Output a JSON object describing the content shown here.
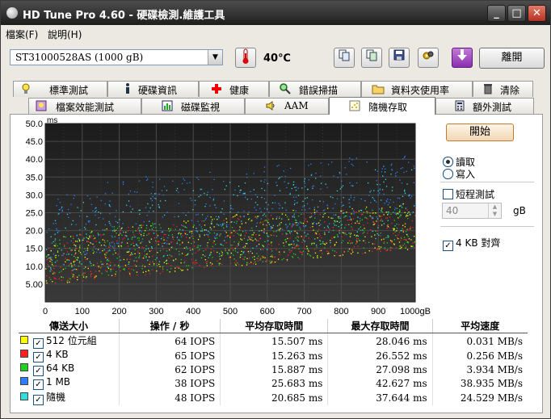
{
  "window": {
    "title": "HD Tune Pro 4.60 - 硬碟檢測.維護工具"
  },
  "menu": {
    "file": "檔案(F)",
    "help": "說明(H)"
  },
  "toolbar": {
    "drive": "ST31000528AS (1000 gB)",
    "temperature": "40℃",
    "exit_label": "離開"
  },
  "tabs": {
    "row1": [
      {
        "label": "標準測試",
        "icon": "lightbulb-icon"
      },
      {
        "label": "硬碟資訊",
        "icon": "info-icon"
      },
      {
        "label": "健康",
        "icon": "health-cross-icon"
      },
      {
        "label": "錯誤掃描",
        "icon": "magnifier-icon"
      },
      {
        "label": "資料夾使用率",
        "icon": "folder-icon"
      },
      {
        "label": "清除",
        "icon": "trash-icon"
      }
    ],
    "row2": [
      {
        "label": "檔案效能測試",
        "icon": "bulb-file-icon"
      },
      {
        "label": "磁碟監視",
        "icon": "monitor-chart-icon"
      },
      {
        "label": "AAM",
        "icon": "speaker-icon"
      },
      {
        "label": "隨機存取",
        "icon": "random-access-icon",
        "active": true
      },
      {
        "label": "額外測試",
        "icon": "calculator-icon"
      }
    ]
  },
  "controls": {
    "start_label": "開始",
    "read_label": "讀取",
    "write_label": "寫入",
    "short_test_label": "短程測試",
    "short_test_value": "40",
    "short_test_unit": "gB",
    "align_label": "4 KB 對齊"
  },
  "chart_data": {
    "type": "scatter",
    "ylabel": "ms",
    "xlabel": "gB",
    "xlim": [
      0,
      1000
    ],
    "ylim": [
      0,
      50
    ],
    "x_ticks": [
      "0",
      "100",
      "200",
      "300",
      "400",
      "500",
      "600",
      "700",
      "800",
      "900",
      "1000gB"
    ],
    "y_ticks": [
      "5.00",
      "10.0",
      "15.0",
      "20.0",
      "25.0",
      "30.0",
      "35.0",
      "40.0",
      "45.0",
      "50.0"
    ],
    "background": "#2b2b2b",
    "grid": true,
    "series": [
      {
        "name": "512 位元組",
        "color": "#ffff00",
        "min_ms": [
          5.0,
          15.0
        ],
        "max_ms": [
          16.0,
          28.0
        ]
      },
      {
        "name": "4 KB",
        "color": "#ff2020",
        "min_ms": [
          5.0,
          15.0
        ],
        "max_ms": [
          16.0,
          27.0
        ]
      },
      {
        "name": "64 KB",
        "color": "#20d020",
        "min_ms": [
          5.5,
          15.5
        ],
        "max_ms": [
          17.0,
          27.0
        ]
      },
      {
        "name": "1 MB",
        "color": "#2a7fff",
        "min_ms": [
          12.0,
          25.0
        ],
        "max_ms": [
          28.0,
          42.0
        ]
      },
      {
        "name": "隨機",
        "color": "#33dddd",
        "min_ms": [
          8.0,
          19.0
        ],
        "max_ms": [
          24.0,
          38.0
        ]
      }
    ]
  },
  "results": {
    "headers": [
      "傳送大小",
      "操作 / 秒",
      "平均存取時間",
      "最大存取時間",
      "平均速度"
    ],
    "rows": [
      {
        "label": "512 位元組",
        "color": "#ffff00",
        "ops": "64 IOPS",
        "avg": "15.507 ms",
        "max": "28.046 ms",
        "speed": "0.031 MB/s"
      },
      {
        "label": "4 KB",
        "color": "#ff2020",
        "ops": "65 IOPS",
        "avg": "15.263 ms",
        "max": "26.552 ms",
        "speed": "0.256 MB/s"
      },
      {
        "label": "64 KB",
        "color": "#20d020",
        "ops": "62 IOPS",
        "avg": "15.887 ms",
        "max": "27.098 ms",
        "speed": "3.934 MB/s"
      },
      {
        "label": "1 MB",
        "color": "#2a7fff",
        "ops": "38 IOPS",
        "avg": "25.683 ms",
        "max": "42.627 ms",
        "speed": "38.935 MB/s"
      },
      {
        "label": "隨機",
        "color": "#33dddd",
        "ops": "48 IOPS",
        "avg": "20.685 ms",
        "max": "37.644 ms",
        "speed": "24.529 MB/s"
      }
    ]
  }
}
